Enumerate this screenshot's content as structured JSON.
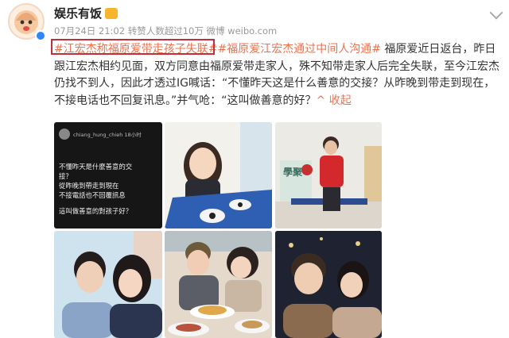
{
  "header": {
    "username": "娱乐有饭",
    "date": "07月24日 21:02",
    "reposts": "转赞人数超过10万",
    "source": "微博 weibo.com"
  },
  "post": {
    "topic1": "#江宏杰称福原爱带走孩子失联#",
    "topic2": "#福原爱江宏杰通过中间人沟通#",
    "body": " 福原爱近日返台，昨日跟江宏杰相约见面，双方同意由福原爱带走家人，殊不知带走家人后完全失联，至今江宏杰仍找不到人，因此才透过IG喊话：“不懂昨天这是什么善意的交接？从昨晚到带走到现在，不接电话也不回复讯息。”并气呛：“这叫做善意的好？",
    "more": "收起",
    "more_arrow": "^"
  },
  "images": [
    {
      "handle": "chiang_hung_chieh",
      "time": "18小时",
      "lines": [
        "不懂昨天是什麼善意的交",
        "接？",
        "從昨晚到帶走到現在",
        "不接電話也不回覆訊息",
        "",
        "這叫做善意的對孩子好？"
      ]
    },
    {},
    {
      "banner": "學聚"
    },
    {},
    {},
    {}
  ],
  "colors": {
    "topic": "#eb7350",
    "highlight_box": "#c0303a",
    "meta": "#999999"
  }
}
